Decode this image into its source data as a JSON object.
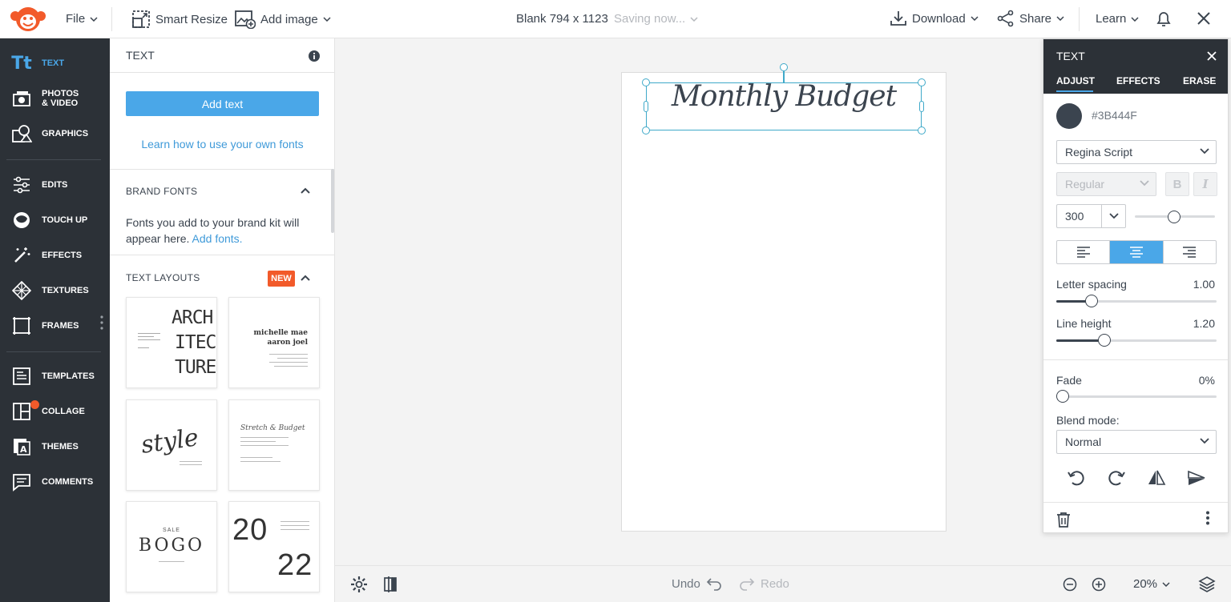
{
  "topbar": {
    "file": "File",
    "smart_resize": "Smart Resize",
    "add_image": "Add image",
    "doc_title": "Blank 794 x 1123",
    "saving": "Saving now...",
    "download": "Download",
    "share": "Share",
    "learn": "Learn"
  },
  "sidebar": {
    "text": "TEXT",
    "photos_1": "PHOTOS",
    "photos_2": "& VIDEO",
    "graphics": "GRAPHICS",
    "edits": "EDITS",
    "touchup": "TOUCH UP",
    "effects": "EFFECTS",
    "textures": "TEXTURES",
    "frames": "FRAMES",
    "templates": "TEMPLATES",
    "collage": "COLLAGE",
    "themes": "THEMES",
    "comments": "COMMENTS",
    "active_color": "#4aa7e8",
    "collage_badge_color": "#f25a2a"
  },
  "text_panel": {
    "title": "TEXT",
    "add_text": "Add text",
    "learn_fonts": "Learn how to use your own fonts",
    "brand_fonts_title": "BRAND FONTS",
    "brand_fonts_desc": "Fonts you add to your brand kit will appear here.",
    "add_fonts": "Add fonts.",
    "text_layouts_title": "TEXT LAYOUTS",
    "new_badge": "NEW",
    "layouts": [
      {
        "lines": [
          "ARCH",
          "ITEC",
          "TURE"
        ]
      },
      {
        "lines": [
          "michelle mae",
          "aaron joel"
        ]
      },
      {
        "lines": [
          "style"
        ]
      },
      {
        "lines": [
          "Stretch & Budget"
        ]
      },
      {
        "lines": [
          "SALE",
          "BOGO"
        ]
      },
      {
        "lines": [
          "20",
          "22"
        ]
      }
    ]
  },
  "canvas": {
    "text": "Monthly Budget"
  },
  "bottombar": {
    "undo": "Undo",
    "redo": "Redo",
    "zoom": "20%"
  },
  "text_props": {
    "title": "TEXT",
    "tabs": [
      "ADJUST",
      "EFFECTS",
      "ERASE"
    ],
    "active_tab": "ADJUST",
    "color_hex": "#3B444F",
    "font": "Regina Script",
    "weight": "Regular",
    "bold": "B",
    "italic": "I",
    "size": "300",
    "alignment": "center",
    "letter_spacing_label": "Letter spacing",
    "letter_spacing_value": "1.00",
    "line_height_label": "Line height",
    "line_height_value": "1.20",
    "fade_label": "Fade",
    "fade_value": "0%",
    "blend_label": "Blend mode:",
    "blend_value": "Normal"
  }
}
